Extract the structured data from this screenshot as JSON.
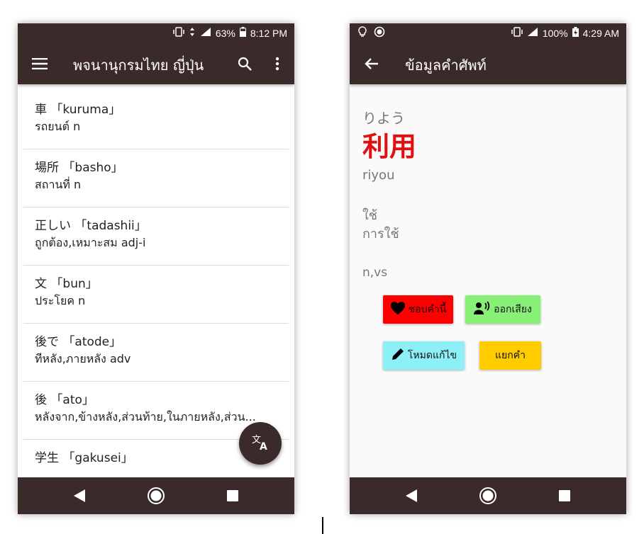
{
  "left_screen": {
    "status": {
      "battery": "63%",
      "time": "8:12 PM",
      "network": "4G"
    },
    "appbar": {
      "title": "พจนานุกรมไทย ญี่ปุ่น"
    },
    "entries": [
      {
        "word": "車 「kuruma」",
        "meaning": "รถยนต์ n"
      },
      {
        "word": "場所 「basho」",
        "meaning": "สถานที่ n"
      },
      {
        "word": "正しい 「tadashii」",
        "meaning": "ถูกต้อง,เหมาะสม adj-i"
      },
      {
        "word": "文 「bun」",
        "meaning": "ประโยค n"
      },
      {
        "word": "後で 「atode」",
        "meaning": "ทีหลัง,ภายหลัง adv"
      },
      {
        "word": "後 「ato」",
        "meaning": "หลังจาก,ข้างหลัง,ส่วนท้าย,ในภายหลัง,ส่วน..."
      },
      {
        "word": "学生 「gakusei」",
        "meaning": ""
      }
    ]
  },
  "right_screen": {
    "status": {
      "battery": "100%",
      "time": "4:29 AM",
      "network": "4G"
    },
    "appbar": {
      "title": "ข้อมูลคำศัพท์"
    },
    "word": {
      "reading": "りよう",
      "kanji": "利用",
      "romaji": "riyou",
      "meaning_1": "ใช้",
      "meaning_2": "การใช้",
      "part_of_speech": "n,vs"
    },
    "buttons": {
      "favorite": "ชอบคำนี้",
      "speak": "ออกเสียง",
      "edit": "โหมดแก้ไข",
      "split": "แยกคำ"
    }
  },
  "colors": {
    "appbar": "#3b2a2a",
    "kanji": "#e01010",
    "favorite": "#ff0000",
    "speak": "#88f077",
    "edit": "#8df0f7",
    "split": "#ffcc00"
  }
}
